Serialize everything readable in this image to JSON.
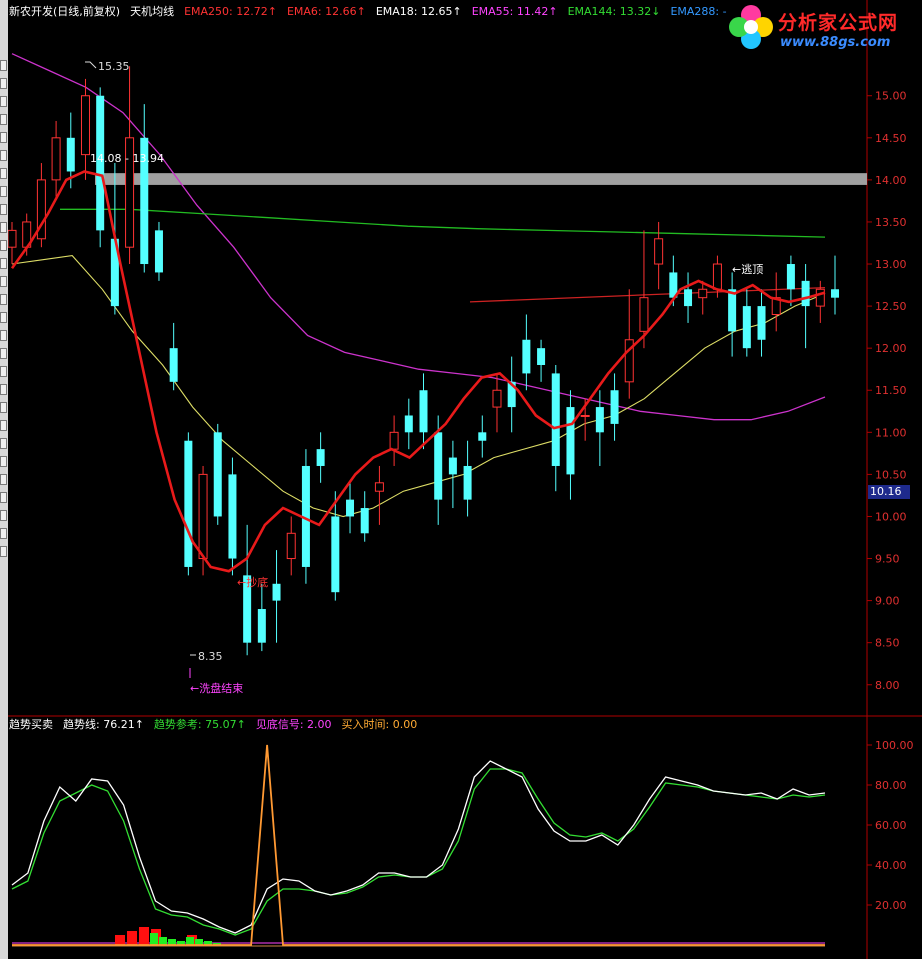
{
  "main_legend": [
    {
      "text": "新农开发(日线,前复权)",
      "color": "#ffffff"
    },
    {
      "text": "天机均线",
      "color": "#ffffff"
    },
    {
      "text": "EMA250: 12.72↑",
      "color": "#ff3333"
    },
    {
      "text": "EMA6: 12.66↑",
      "color": "#ff3333"
    },
    {
      "text": "EMA18: 12.65↑",
      "color": "#ffffff"
    },
    {
      "text": "EMA55: 11.42↑",
      "color": "#ff44ff"
    },
    {
      "text": "EMA144: 13.32↓",
      "color": "#33dd33"
    },
    {
      "text": "EMA288: -",
      "color": "#3399ff"
    }
  ],
  "sub_legend": [
    {
      "text": "趋势买卖",
      "color": "#ffffff"
    },
    {
      "text": "趋势线: 76.21↑",
      "color": "#ffffff"
    },
    {
      "text": "趋势参考: 75.07↑",
      "color": "#33dd33"
    },
    {
      "text": "见底信号: 2.00",
      "color": "#ff44ff"
    },
    {
      "text": "买入时间: 0.00",
      "color": "#ffaa33"
    }
  ],
  "logo": {
    "title": "分析家公式网",
    "url_text": "www.88gs.com"
  },
  "current_price": "10.16",
  "annotations": {
    "high_label": "15.35",
    "zone_label": "14.08 - 13.94",
    "low_label": "8.35",
    "washout": "←洗盘结束",
    "bottom_fish": "←抄底",
    "escape_top": "←逃顶"
  },
  "icons": [
    "toolbar-button-icon",
    "logo-flower-icon"
  ],
  "chart_data": [
    {
      "type": "candlestick",
      "title": "新农开发(日线,前复权) 天机均线",
      "ylim": [
        7.7,
        15.9
      ],
      "y_ticks": [
        8.0,
        8.5,
        9.0,
        9.5,
        10.0,
        10.5,
        11.0,
        11.5,
        12.0,
        12.5,
        13.0,
        13.5,
        14.0,
        14.5,
        15.0
      ],
      "resistance_zone": [
        13.94,
        14.08
      ],
      "candles": [
        [
          13.2,
          13.4,
          13.0,
          13.5
        ],
        [
          13.2,
          13.5,
          13.1,
          13.6
        ],
        [
          13.3,
          14.0,
          13.2,
          14.2
        ],
        [
          14.0,
          14.5,
          13.8,
          14.7
        ],
        [
          14.5,
          14.1,
          13.9,
          14.8
        ],
        [
          14.3,
          15.0,
          14.0,
          15.2
        ],
        [
          15.0,
          13.4,
          13.2,
          15.1
        ],
        [
          13.3,
          12.5,
          12.4,
          14.2
        ],
        [
          13.2,
          14.5,
          13.0,
          15.35
        ],
        [
          14.5,
          13.0,
          12.9,
          14.9
        ],
        [
          13.4,
          12.9,
          12.8,
          13.5
        ],
        [
          12.0,
          11.6,
          11.5,
          12.3
        ],
        [
          10.9,
          9.4,
          9.3,
          11.0
        ],
        [
          9.5,
          10.5,
          9.3,
          10.6
        ],
        [
          11.0,
          10.0,
          9.9,
          11.1
        ],
        [
          10.5,
          9.5,
          9.3,
          10.7
        ],
        [
          9.3,
          8.5,
          8.35,
          9.9
        ],
        [
          8.9,
          8.5,
          8.4,
          9.2
        ],
        [
          9.2,
          9.0,
          8.5,
          9.6
        ],
        [
          9.5,
          9.8,
          9.3,
          10.0
        ],
        [
          10.6,
          9.4,
          9.2,
          10.8
        ],
        [
          10.8,
          10.6,
          10.4,
          11.0
        ],
        [
          10.0,
          9.1,
          9.0,
          10.3
        ],
        [
          10.2,
          10.0,
          9.8,
          10.4
        ],
        [
          10.1,
          9.8,
          9.7,
          10.3
        ],
        [
          10.3,
          10.4,
          9.9,
          10.6
        ],
        [
          10.8,
          11.0,
          10.6,
          11.2
        ],
        [
          11.2,
          11.0,
          10.8,
          11.4
        ],
        [
          11.5,
          11.0,
          10.8,
          11.7
        ],
        [
          11.0,
          10.2,
          9.9,
          11.2
        ],
        [
          10.7,
          10.5,
          10.1,
          10.9
        ],
        [
          10.6,
          10.2,
          10.0,
          10.9
        ],
        [
          11.0,
          10.9,
          10.7,
          11.2
        ],
        [
          11.3,
          11.5,
          11.0,
          11.7
        ],
        [
          11.6,
          11.3,
          11.0,
          11.9
        ],
        [
          12.1,
          11.7,
          11.5,
          12.4
        ],
        [
          12.0,
          11.8,
          11.6,
          12.1
        ],
        [
          11.7,
          10.6,
          10.3,
          11.8
        ],
        [
          11.3,
          10.5,
          10.2,
          11.5
        ],
        [
          11.2,
          11.2,
          10.9,
          11.4
        ],
        [
          11.3,
          11.0,
          10.6,
          11.5
        ],
        [
          11.5,
          11.1,
          10.9,
          11.7
        ],
        [
          11.6,
          12.1,
          11.4,
          12.7
        ],
        [
          12.2,
          12.6,
          12.0,
          13.4
        ],
        [
          13.0,
          13.3,
          12.7,
          13.5
        ],
        [
          12.9,
          12.6,
          12.5,
          13.1
        ],
        [
          12.7,
          12.5,
          12.3,
          12.9
        ],
        [
          12.6,
          12.7,
          12.4,
          12.8
        ],
        [
          12.7,
          13.0,
          12.6,
          13.1
        ],
        [
          12.7,
          12.2,
          11.9,
          12.9
        ],
        [
          12.5,
          12.0,
          11.9,
          12.7
        ],
        [
          12.5,
          12.1,
          11.9,
          12.7
        ],
        [
          12.4,
          12.6,
          12.2,
          12.9
        ],
        [
          13.0,
          12.7,
          12.5,
          13.1
        ],
        [
          12.8,
          12.5,
          12.0,
          13.0
        ],
        [
          12.5,
          12.7,
          12.3,
          12.8
        ],
        [
          12.7,
          12.6,
          12.4,
          13.1
        ]
      ],
      "ema6": [
        12.95,
        13.25,
        13.6,
        14.0,
        14.1,
        14.05,
        13.0,
        12.0,
        11.0,
        10.2,
        9.7,
        9.4,
        9.35,
        9.5,
        9.9,
        10.1,
        10.0,
        9.9,
        10.2,
        10.5,
        10.7,
        10.8,
        10.7,
        10.9,
        11.1,
        11.4,
        11.65,
        11.7,
        11.5,
        11.2,
        11.05,
        11.1,
        11.4,
        11.7,
        11.95,
        12.15,
        12.4,
        12.7,
        12.8,
        12.7,
        12.65,
        12.75,
        12.6,
        12.55,
        12.6,
        12.66
      ],
      "ema18": [
        13.0,
        13.05,
        13.1,
        12.7,
        12.2,
        11.8,
        11.3,
        10.9,
        10.6,
        10.3,
        10.1,
        10.0,
        10.1,
        10.3,
        10.4,
        10.5,
        10.7,
        10.8,
        10.9,
        11.1,
        11.2,
        11.4,
        11.7,
        12.0,
        12.2,
        12.3,
        12.5,
        12.65
      ],
      "ema55": [
        15.5,
        15.3,
        15.1,
        14.8,
        14.3,
        13.7,
        13.2,
        12.6,
        12.15,
        11.95,
        11.85,
        11.75,
        11.7,
        11.65,
        11.55,
        11.45,
        11.35,
        11.25,
        11.2,
        11.15,
        11.15,
        11.25,
        11.42
      ],
      "ema144": [
        13.65,
        13.65,
        13.6,
        13.55,
        13.5,
        13.45,
        13.42,
        13.4,
        13.38,
        13.36,
        13.34,
        13.32
      ],
      "ema250": [
        12.55,
        12.72
      ]
    },
    {
      "type": "line",
      "title": "趋势买卖",
      "ylim": [
        0,
        110
      ],
      "y_ticks": [
        20.0,
        40.0,
        60.0,
        80.0,
        100.0
      ],
      "series": [
        {
          "name": "趋势线",
          "values": [
            30,
            36,
            62,
            79,
            72,
            83,
            82,
            70,
            44,
            22,
            17,
            16,
            13,
            9,
            6,
            10,
            28,
            33,
            32,
            27,
            25,
            27,
            30,
            36,
            36,
            34,
            34,
            40,
            58,
            84,
            92,
            88,
            84,
            68,
            57,
            52,
            52,
            55,
            50,
            60,
            73,
            84,
            82,
            80,
            77,
            76,
            75,
            76,
            73,
            78,
            75,
            76
          ]
        },
        {
          "name": "趋势参考",
          "values": [
            28,
            32,
            56,
            72,
            76,
            80,
            77,
            62,
            38,
            18,
            15,
            14,
            10,
            8,
            5,
            8,
            22,
            28,
            28,
            27,
            25,
            26,
            29,
            34,
            35,
            34,
            34,
            38,
            52,
            78,
            88,
            88,
            86,
            73,
            61,
            55,
            54,
            56,
            52,
            58,
            69,
            81,
            80,
            79,
            77,
            76,
            75,
            74,
            73,
            75,
            74,
            75
          ]
        },
        {
          "name": "买入时间",
          "values": [
            0,
            0,
            0,
            0,
            0,
            0,
            0,
            0,
            0,
            0,
            0,
            0,
            0,
            0,
            0,
            0,
            100,
            0,
            0,
            0,
            0,
            0,
            0,
            0,
            0,
            0,
            0,
            0,
            0,
            0,
            0,
            0,
            0,
            0,
            0,
            0,
            0,
            0,
            0,
            0,
            0,
            0,
            0,
            0,
            0,
            0,
            0,
            0,
            0,
            0,
            0,
            0
          ]
        }
      ],
      "bars": [
        {
          "name": "red",
          "values": [
            5,
            7,
            9,
            8,
            0,
            0,
            5
          ]
        },
        {
          "name": "green",
          "values": [
            6,
            4,
            3,
            2,
            4,
            3,
            2,
            1
          ]
        }
      ]
    }
  ]
}
